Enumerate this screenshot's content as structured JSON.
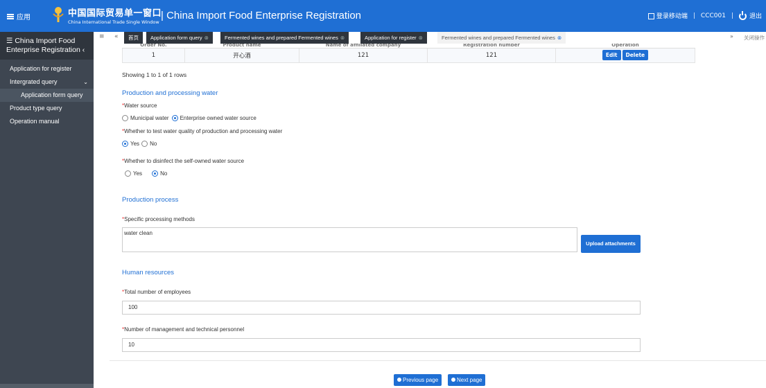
{
  "header": {
    "menu_label": "应用",
    "brand_cn": "中国国际贸易单一窗口",
    "brand_en": "China International Trade Single Window",
    "app_title": "| China Import Food Enterprise Registration",
    "mobile_login": "登录移动端",
    "user": "CCC001",
    "logout": "退出",
    "sep": "|"
  },
  "sidebar": {
    "title_line1": "China Import Food",
    "title_line2": "Enterprise Registration",
    "items": [
      {
        "label": "Application for register"
      },
      {
        "label": "Intergrated query"
      },
      {
        "label": "Application form query"
      },
      {
        "label": "Product type query"
      },
      {
        "label": "Operation manual"
      }
    ]
  },
  "tabs": {
    "items": [
      {
        "label": "首页"
      },
      {
        "label": "Application form query"
      },
      {
        "label": "Fermented wines and prepared Fermented wines"
      },
      {
        "label": "Application for register"
      },
      {
        "label": "Fermented wines and prepared Fermented wines"
      }
    ],
    "close_ops": "关闭操作"
  },
  "table": {
    "headers": [
      "Order No.",
      "Product name",
      "Name of affiliated company",
      "Registration number",
      "Operation"
    ],
    "rows": [
      {
        "order": "1",
        "product": "开心酒",
        "company": "121",
        "reg": "121"
      }
    ],
    "edit_label": "Edit",
    "delete_label": "Delete",
    "showing": "Showing 1 to 1 of 1 rows"
  },
  "water": {
    "section_title": "Production and processing water",
    "source_label": "Water source",
    "source_options": [
      "Municipal water",
      "Enterprise owned water source"
    ],
    "source_selected": 1,
    "test_label": "Whether to test water quality of production and processing water",
    "test_options": [
      "Yes",
      "No"
    ],
    "disinfect_label": "Whether to disinfect the self-owned water source",
    "disinfect_options": [
      "Yes",
      "No"
    ]
  },
  "process": {
    "section_title": "Production process",
    "methods_label": "Specific processing methods",
    "methods_value": "water clean",
    "upload_label": "Upload attachments"
  },
  "hr": {
    "section_title": "Human resources",
    "employees_label": "Total number of employees",
    "employees_value": "100",
    "mgmt_label": "Number of management and technical personnel",
    "mgmt_value": "10"
  },
  "nav": {
    "prev_label": "Previous page",
    "next_label": "Next page"
  },
  "required_mark": "*",
  "colors": {
    "primary": "#1f6fd4",
    "sidebar": "#3e4651",
    "tab_dark": "#2f353d"
  }
}
